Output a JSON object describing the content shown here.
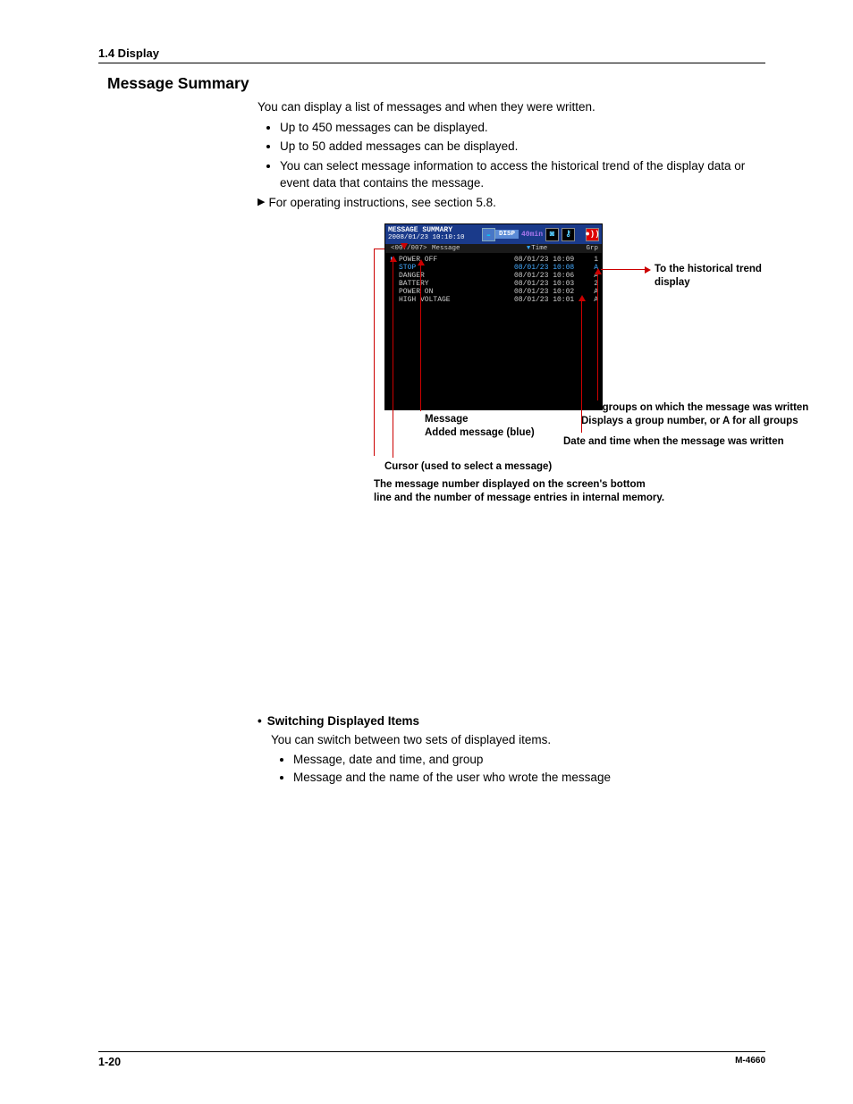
{
  "header": {
    "section": "1.4  Display"
  },
  "title": "Message Summary",
  "intro": {
    "lead": "You can display a list of messages and when they were written.",
    "bullets": [
      "Up to 450 messages can be displayed.",
      "Up to 50 added messages can be displayed.",
      "You can select message information to access the historical trend of the display data or event data that contains the message."
    ],
    "ref": "For operating instructions, see section 5.8."
  },
  "device": {
    "title": "MESSAGE SUMMARY",
    "timestamp": "2008/01/23 10:10:10",
    "mode": "DISP",
    "interval": "40min",
    "cols": {
      "count": "<007/007>",
      "message": "Message",
      "time": "Time",
      "grp": "Grp"
    },
    "rows": [
      {
        "msg": "POWER OFF",
        "time": "08/01/23 10:09",
        "grp": "1",
        "ptr": true,
        "blue": false
      },
      {
        "msg": "STOP",
        "time": "08/01/23 10:08",
        "grp": "A",
        "ptr": false,
        "blue": true
      },
      {
        "msg": "DANGER",
        "time": "08/01/23 10:06",
        "grp": "A",
        "ptr": false,
        "blue": false
      },
      {
        "msg": "BATTERY",
        "time": "08/01/23 10:03",
        "grp": "2",
        "ptr": false,
        "blue": false
      },
      {
        "msg": "POWER ON",
        "time": "08/01/23 10:02",
        "grp": "A",
        "ptr": false,
        "blue": false
      },
      {
        "msg": "HIGH VOLTAGE",
        "time": "08/01/23 10:01",
        "grp": "A",
        "ptr": false,
        "blue": false
      }
    ]
  },
  "callouts": {
    "trend": "To the historical trend display",
    "groups_line1": "The groups on which the message was written",
    "groups_line2": "Displays a group number, or A for all groups",
    "date_time": "Date and time when the message was written",
    "message": "Message",
    "added": "Added message (blue)",
    "cursor": "Cursor (used to select a message)",
    "msg_num_line1": "The message number displayed on the screen's bottom",
    "msg_num_line2": "line and the number of messages entries in internal memory."
  },
  "subsection": {
    "title": "Switching Displayed Items",
    "lead": "You can switch between two sets of displayed items.",
    "bullets": [
      "Message, date and time, and group",
      "Message and the name of the user who wrote the message"
    ]
  },
  "footer": {
    "page": "1-20",
    "pub": "M-4660"
  },
  "callouts_fix": {
    "msg_num_line2": "line and the number of message entries in internal memory."
  }
}
